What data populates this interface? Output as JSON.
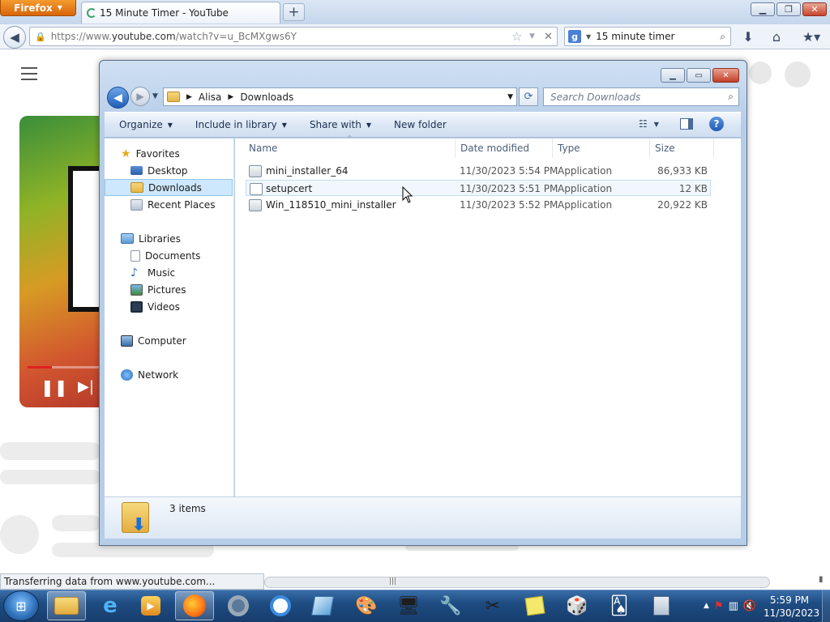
{
  "browser": {
    "menu_label": "Firefox",
    "tab_title": "15 Minute Timer - YouTube",
    "url_prefix": "https://www.",
    "url_host": "youtube.com",
    "url_path": "/watch?v=u_BcMXgws6Y",
    "search_value": "15 minute timer",
    "status_text": "Transferring data from www.youtube.com..."
  },
  "explorer": {
    "breadcrumb": [
      "Alisa",
      "Downloads"
    ],
    "search_placeholder": "Search Downloads",
    "toolbar": {
      "organize": "Organize",
      "include_in_library": "Include in library",
      "share_with": "Share with",
      "new_folder": "New folder"
    },
    "nav": {
      "favorites": "Favorites",
      "desktop": "Desktop",
      "downloads": "Downloads",
      "recent_places": "Recent Places",
      "libraries": "Libraries",
      "documents": "Documents",
      "music": "Music",
      "pictures": "Pictures",
      "videos": "Videos",
      "computer": "Computer",
      "network": "Network"
    },
    "columns": {
      "name": "Name",
      "date_modified": "Date modified",
      "type": "Type",
      "size": "Size"
    },
    "files": [
      {
        "name": "mini_installer_64",
        "date": "11/30/2023 5:54 PM",
        "type": "Application",
        "size": "86,933 KB"
      },
      {
        "name": "setupcert",
        "date": "11/30/2023 5:51 PM",
        "type": "Application",
        "size": "12 KB"
      },
      {
        "name": "Win_118510_mini_installer",
        "date": "11/30/2023 5:52 PM",
        "type": "Application",
        "size": "20,922 KB"
      }
    ],
    "item_count": "3 items"
  },
  "taskbar": {
    "time": "5:59 PM",
    "date": "11/30/2023"
  },
  "colors": {
    "accent": "#3a6ea8",
    "selection": "#cde8fc",
    "firefox_orange": "#e67816"
  }
}
